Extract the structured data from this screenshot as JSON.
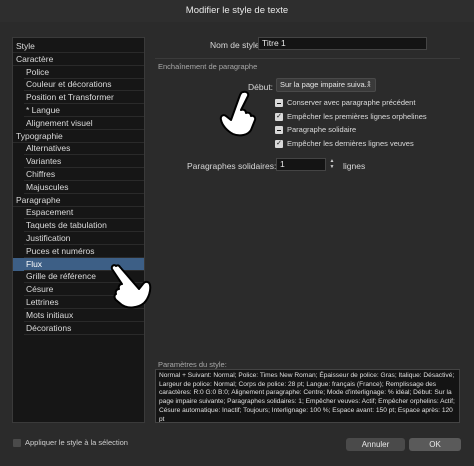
{
  "window": {
    "title": "Modifier le style de texte"
  },
  "sidebar": {
    "items": [
      {
        "label": "Style",
        "level": 0,
        "selected": false
      },
      {
        "label": "Caractère",
        "level": 0,
        "selected": false
      },
      {
        "label": "Police",
        "level": 1,
        "selected": false
      },
      {
        "label": "Couleur et décorations",
        "level": 1,
        "selected": false
      },
      {
        "label": "Position et Transformer",
        "level": 1,
        "selected": false
      },
      {
        "label": "* Langue",
        "level": 1,
        "selected": false
      },
      {
        "label": "Alignement visuel",
        "level": 1,
        "selected": false
      },
      {
        "label": "Typographie",
        "level": 0,
        "selected": false
      },
      {
        "label": "Alternatives",
        "level": 1,
        "selected": false
      },
      {
        "label": "Variantes",
        "level": 1,
        "selected": false
      },
      {
        "label": "Chiffres",
        "level": 1,
        "selected": false
      },
      {
        "label": "Majuscules",
        "level": 1,
        "selected": false
      },
      {
        "label": "Paragraphe",
        "level": 0,
        "selected": false
      },
      {
        "label": "Espacement",
        "level": 1,
        "selected": false
      },
      {
        "label": "Taquets de tabulation",
        "level": 1,
        "selected": false
      },
      {
        "label": "Justification",
        "level": 1,
        "selected": false
      },
      {
        "label": "Puces et numéros",
        "level": 1,
        "selected": false
      },
      {
        "label": "Flux",
        "level": 1,
        "selected": true
      },
      {
        "label": "Grille de référence",
        "level": 1,
        "selected": false
      },
      {
        "label": "Césure",
        "level": 1,
        "selected": false
      },
      {
        "label": "Lettrines",
        "level": 1,
        "selected": false
      },
      {
        "label": "Mots initiaux",
        "level": 1,
        "selected": false
      },
      {
        "label": "Décorations",
        "level": 1,
        "selected": false
      }
    ]
  },
  "form": {
    "style_name_label": "Nom de style:",
    "style_name_value": "Titre 1",
    "section_title": "Enchaînement de paragraphe",
    "start_label": "Début:",
    "start_value": "Sur la page impaire suiva...",
    "checkboxes": [
      {
        "label": "Conserver avec paragraphe précédent",
        "state": "mixed"
      },
      {
        "label": "Empêcher les premières lignes orphelines",
        "state": "checked"
      },
      {
        "label": "Paragraphe solidaire",
        "state": "mixed"
      },
      {
        "label": "Empêcher les dernières lignes veuves",
        "state": "checked"
      }
    ],
    "solid_lines_label": "Paragraphes solidaires:",
    "solid_lines_value": "1",
    "solid_lines_unit": "lignes"
  },
  "summary": {
    "title": "Paramètres du style:",
    "text": "Normal + Suivant: Normal; Police: Times New Roman; Épaisseur de police: Gras; Italique: Désactivé; Largeur de police: Normal; Corps de police: 28 pt; Langue: français (France); Remplissage des caractères: R:0 G:0 B:0; Alignement paragraphe: Centre; Mode d'interlignage: % idéal; Début: Sur la page impaire suivante; Paragraphes solidaires: 1; Empêcher veuves: Actif; Empêcher orphelins: Actif; Césure automatique: Inactif; Toujours; Interlignage: 100 %; Espace avant: 150 pt; Espace après: 120 pt"
  },
  "footer": {
    "apply_label": "Appliquer le style à la sélection",
    "cancel_label": "Annuler",
    "ok_label": "OK"
  },
  "icons": {
    "cursor": "hand-pointer-icon",
    "check": "checkmark-icon",
    "dropdown": "updown-arrows-icon"
  },
  "colors": {
    "selection": "#3d5f86",
    "panel": "#2b2b2b",
    "sidebar": "#161616"
  }
}
